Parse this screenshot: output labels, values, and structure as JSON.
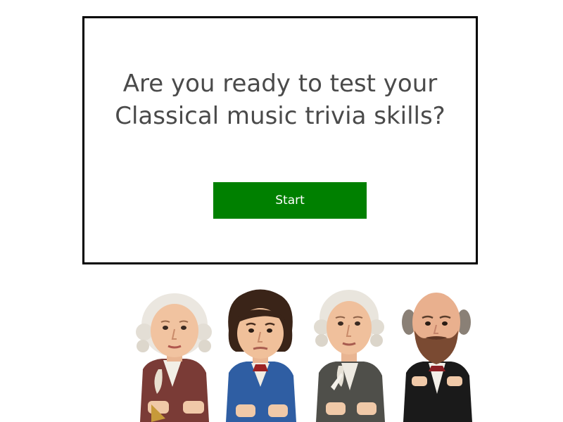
{
  "quiz": {
    "question": "Are you ready to test your Classical music trivia skills?",
    "start_label": "Start"
  },
  "colors": {
    "start_button": "#008000",
    "question_text": "#4a4a4a",
    "card_border": "#000000"
  },
  "illustration": {
    "figures": [
      "mozart-figurine",
      "beethoven-figurine",
      "bach-figurine",
      "tchaikovsky-figurine"
    ]
  }
}
